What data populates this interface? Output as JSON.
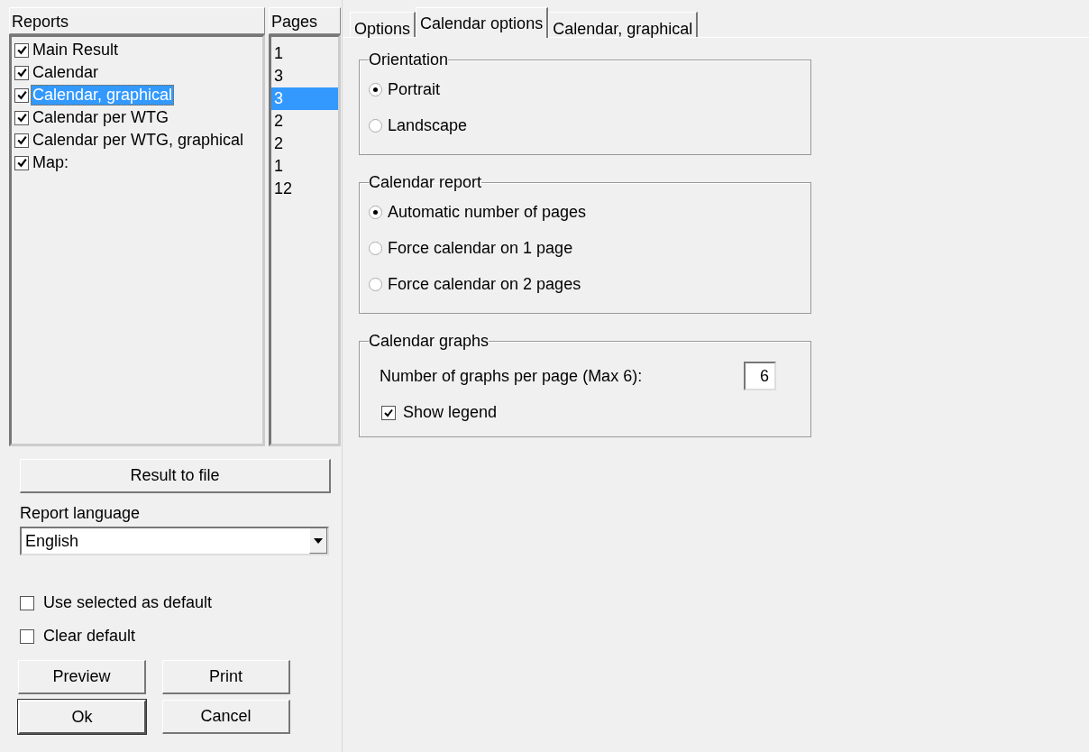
{
  "reports": {
    "heading": "Reports",
    "items": [
      {
        "label": "Main Result",
        "checked": true,
        "selected": false
      },
      {
        "label": "Calendar",
        "checked": true,
        "selected": false
      },
      {
        "label": "Calendar, graphical",
        "checked": true,
        "selected": true
      },
      {
        "label": "Calendar per WTG",
        "checked": true,
        "selected": false
      },
      {
        "label": "Calendar per WTG, graphical",
        "checked": true,
        "selected": false
      },
      {
        "label": "Map:",
        "checked": true,
        "selected": false
      }
    ]
  },
  "pages": {
    "heading": "Pages",
    "items": [
      {
        "value": "1",
        "selected": false
      },
      {
        "value": "3",
        "selected": false
      },
      {
        "value": "3",
        "selected": true
      },
      {
        "value": "2",
        "selected": false
      },
      {
        "value": "2",
        "selected": false
      },
      {
        "value": "1",
        "selected": false
      },
      {
        "value": "12",
        "selected": false
      }
    ]
  },
  "result_button": "Result to file",
  "language": {
    "label": "Report language",
    "value": "English"
  },
  "checkboxes": [
    {
      "label": "Use selected as default",
      "checked": false
    },
    {
      "label": "Clear default",
      "checked": false
    }
  ],
  "buttons": [
    {
      "label": "Preview",
      "default": false
    },
    {
      "label": "Print",
      "default": false
    },
    {
      "label": "Ok",
      "default": true
    },
    {
      "label": "Cancel",
      "default": false
    }
  ],
  "tabs": [
    {
      "label": "Options",
      "selected": false
    },
    {
      "label": "Calendar options",
      "selected": true
    },
    {
      "label": "Calendar, graphical",
      "selected": false
    }
  ],
  "orientation": {
    "title": "Orientation",
    "options": [
      {
        "label": "Portrait",
        "selected": true
      },
      {
        "label": "Landscape",
        "selected": false
      }
    ]
  },
  "calendar_report": {
    "title": "Calendar report",
    "options": [
      {
        "label": "Automatic number of pages",
        "selected": true
      },
      {
        "label": "Force calendar on 1 page",
        "selected": false
      },
      {
        "label": "Force calendar on 2 pages",
        "selected": false
      }
    ]
  },
  "calendar_graphs": {
    "title": "Calendar graphs",
    "graphs_label": "Number of graphs per page (Max 6):",
    "graphs_value": "6",
    "legend": {
      "label": "Show legend",
      "checked": true
    }
  }
}
